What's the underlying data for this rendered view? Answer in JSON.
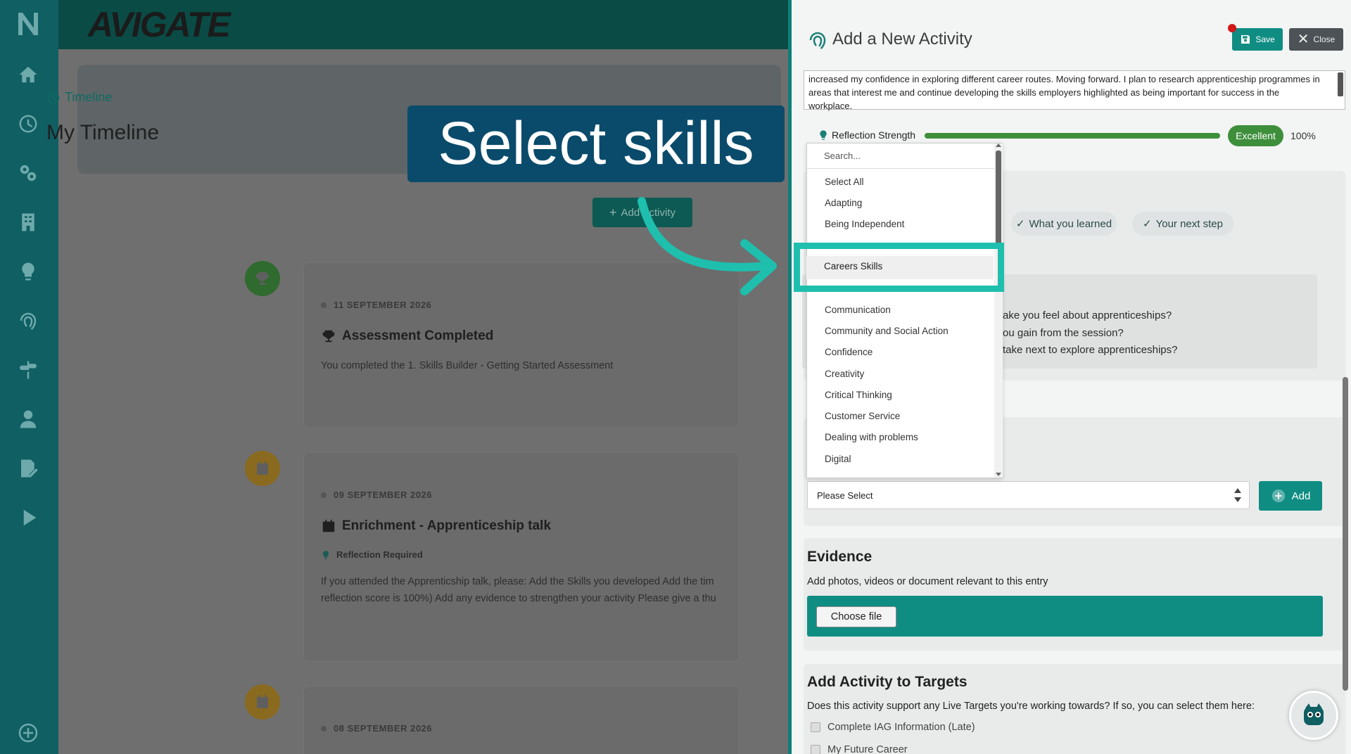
{
  "brand": "AVIGATE",
  "timeline": {
    "crumb": "Timeline",
    "title": "My Timeline",
    "add_activity_label": "Add Activity",
    "entries": [
      {
        "date": "11 SEPTEMBER 2026",
        "title": "Assessment Completed",
        "text": "You completed the 1. Skills Builder - Getting Started Assessment"
      },
      {
        "date": "09 SEPTEMBER 2026",
        "title": "Enrichment - Apprenticeship talk",
        "flag": "Reflection Required",
        "text1": "If you attended the Apprenticship talk, please: Add the Skills you developed Add the tim",
        "text2": "reflection score is 100%) Add any evidence to strengthen your activity Please give a thu"
      },
      {
        "date": "08 SEPTEMBER 2026"
      }
    ]
  },
  "annotation": {
    "text": "Select skills"
  },
  "panel": {
    "title": "Add a New Activity",
    "save_label": "Save",
    "close_label": "Close",
    "reflection_text": "increased my confidence in exploring different career routes. Moving forward. I plan to research apprenticeship programmes in areas that interest me and continue developing the skills employers highlighted as being important for success in the workplace.",
    "strength": {
      "label": "Reflection Strength",
      "badge": "Excellent",
      "percent": "100%",
      "value_fraction": 1.0
    },
    "steps": [
      "What you learned",
      "Your next step"
    ],
    "prompts": [
      "ake you feel about apprenticeships?",
      "ou gain from the session?",
      " take next to explore apprenticeships?"
    ],
    "skills_select": {
      "placeholder": "Please Select",
      "add_label": "Add"
    },
    "evidence": {
      "title": "Evidence",
      "description": "Add photos, videos or document relevant to this entry",
      "choose_file_label": "Choose file"
    },
    "targets": {
      "title": "Add Activity to Targets",
      "description": "Does this activity support any Live Targets you're working towards? If so, you can select them here:",
      "items": [
        "Complete IAG Information (Late)",
        "My Future Career"
      ]
    }
  },
  "dropdown": {
    "search_placeholder": "Search...",
    "items": [
      "Select All",
      "Adapting",
      "Being Independent",
      "Careers Skills",
      "Communication",
      "Community and Social Action",
      "Confidence",
      "Creativity",
      "Critical Thinking",
      "Customer Service",
      "Dealing with problems",
      "Digital"
    ]
  },
  "colors": {
    "sidebar": "#0f5f63",
    "accent": "#0f8d83",
    "highlight": "#1fbfae",
    "success": "#3e8f3c",
    "annotation": "#0a4b6b"
  }
}
